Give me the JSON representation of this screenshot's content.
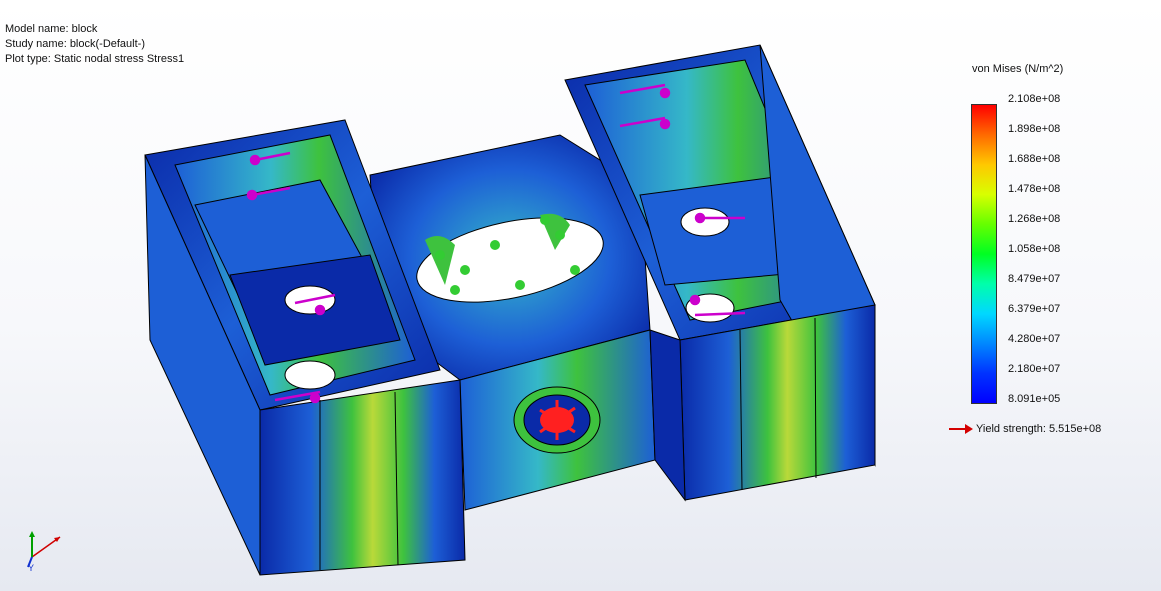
{
  "header": {
    "model_name": "Model name: block",
    "study_name": "Study name: block(-Default-)",
    "plot_type": "Plot type: Static nodal stress Stress1"
  },
  "legend": {
    "title": "von Mises (N/m^2)",
    "ticks": [
      "2.108e+08",
      "1.898e+08",
      "1.688e+08",
      "1.478e+08",
      "1.268e+08",
      "1.058e+08",
      "8.479e+07",
      "6.379e+07",
      "4.280e+07",
      "2.180e+07",
      "8.091e+05"
    ],
    "colors": [
      "#ff0000",
      "#ff6a00",
      "#ffc800",
      "#d8ff00",
      "#66ff00",
      "#00ff22",
      "#00ffaa",
      "#00d8ff",
      "#0088ff",
      "#0033ff",
      "#0000ff"
    ],
    "yield_label": "Yield strength: 5.515e+08",
    "yield_color": "#d40000"
  },
  "model_colors": {
    "dark_blue": "#0a2aa8",
    "mid_blue": "#1d5fd6",
    "green": "#3ec23e",
    "yellow_green": "#b9d93a",
    "cyan": "#35b8c8",
    "fixture": "#cc00cc",
    "load": "#33cc33"
  },
  "triad": {
    "x_color": "#d00000",
    "y_color": "#00a000",
    "z_color": "#1030d0",
    "y_label": "Y"
  }
}
